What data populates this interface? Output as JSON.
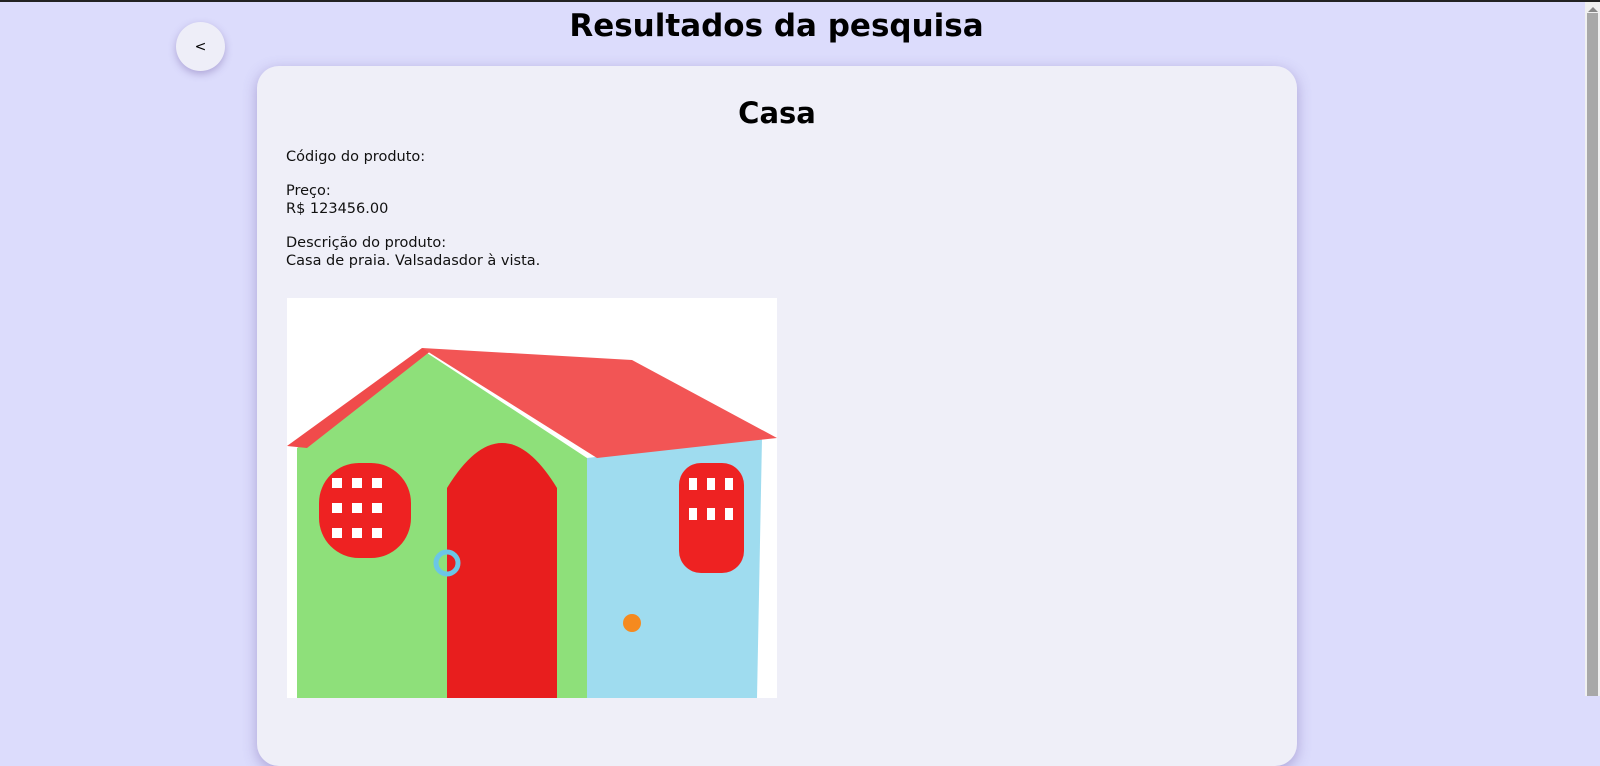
{
  "header": {
    "title": "Resultados da pesquisa",
    "back_label": "<"
  },
  "product": {
    "name": "Casa",
    "code_label": "Código do produto:",
    "code_value": "",
    "price_label": "Preço:",
    "price_value": "R$ 123456.00",
    "description_label": "Descrição do produto:",
    "description_value": "Casa de praia. Valsadasdor à vista."
  }
}
